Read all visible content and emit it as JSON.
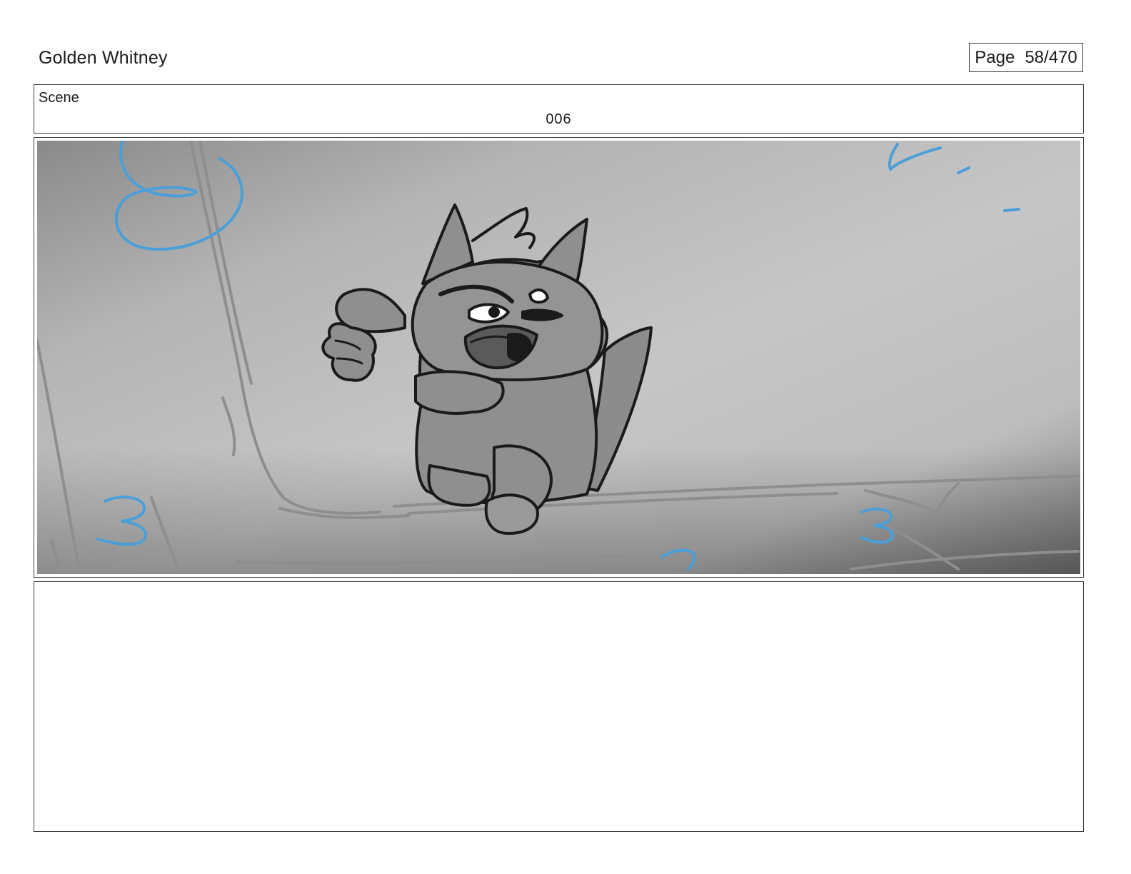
{
  "header": {
    "project_title": "Golden Whitney",
    "page_label": "Page",
    "page_number": "58/470"
  },
  "scene": {
    "label": "Scene",
    "number": "006"
  },
  "panel": {
    "content": "storyboard-sketch",
    "sketch_color": "#1a1a1a",
    "annotation_color": "#4a9fd8"
  },
  "notes": {
    "text": ""
  }
}
